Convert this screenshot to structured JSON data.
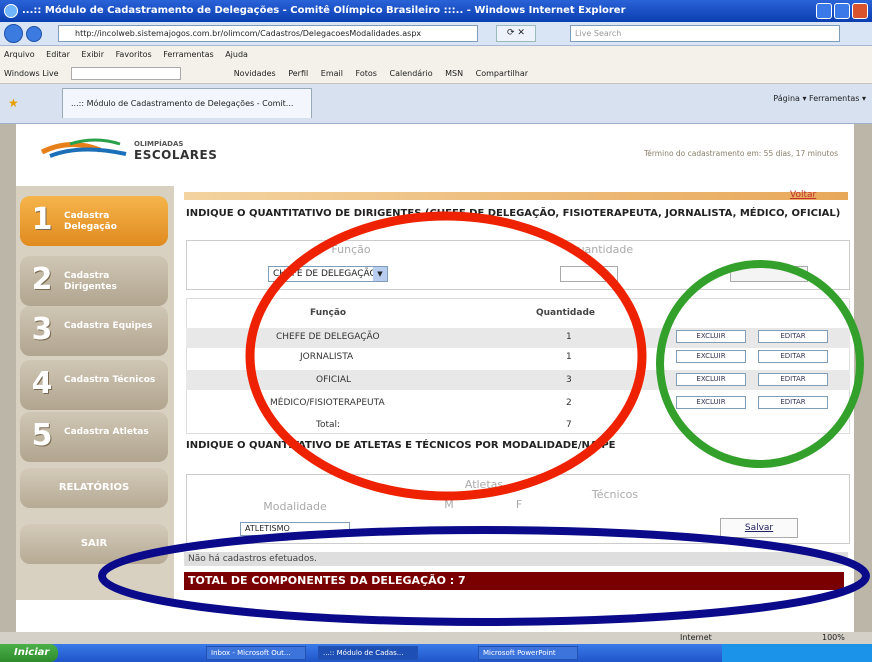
{
  "browser": {
    "title": "...:: Módulo de Cadastramento de Delegações - Comitê Olímpico Brasileiro :::.. - Windows Internet Explorer",
    "address": "http://incolweb.sistemajogos.com.br/olimcom/Cadastros/DelegacoesModalidades.aspx",
    "search_placeholder": "Live Search",
    "menu": [
      "Arquivo",
      "Editar",
      "Exibir",
      "Favoritos",
      "Ferramentas",
      "Ajuda"
    ],
    "links_bar": [
      "Windows Live",
      "Novidades",
      "Perfil",
      "Email",
      "Fotos",
      "Calendário",
      "MSN",
      "Compartilhar"
    ],
    "tab_label": "...:: Módulo de Cadastramento de Delegações - Comit...",
    "tab_tools": "Página ▾   Ferramentas ▾",
    "status_zone": "Internet",
    "zoom": "100%"
  },
  "header": {
    "logo_top": "OLIMPÍADAS",
    "logo_bottom": "ESCOLARES",
    "remaining": "Término do cadastramento em: 55 dias, 17 minutos"
  },
  "sidebar": {
    "steps": [
      {
        "num": "1",
        "label": "Cadastra Delegação"
      },
      {
        "num": "2",
        "label": "Cadastra Dirigentes"
      },
      {
        "num": "3",
        "label": "Cadastra Equipes"
      },
      {
        "num": "4",
        "label": "Cadastra Técnicos"
      },
      {
        "num": "5",
        "label": "Cadastra Atletas"
      }
    ],
    "reports": "RELATÓRIOS",
    "exit": "SAIR"
  },
  "main": {
    "back": "Voltar",
    "heading1": "INDIQUE O QUANTITATIVO DE DIRIGENTES (CHEFE DE DELEGAÇÃO, FISIOTERAPEUTA, JORNALISTA, MÉDICO, OFICIAL)",
    "form_func_header": "Função",
    "form_qty_header": "Quantidade",
    "func_selected": "CHEFE DE DELEGAÇÃO",
    "table_headers": [
      "Função",
      "Quantidade"
    ],
    "rows": [
      {
        "func": "CHEFE DE DELEGAÇÃO",
        "qty": "1"
      },
      {
        "func": "JORNALISTA",
        "qty": "1"
      },
      {
        "func": "OFICIAL",
        "qty": "3"
      },
      {
        "func": "MÉDICO/FISIOTERAPEUTA",
        "qty": "2"
      }
    ],
    "total_label": "Total:",
    "total_value": "7",
    "delete_label": "EXCLUIR",
    "edit_label": "EDITAR",
    "heading2": "INDIQUE O QUANTITATIVO DE ATLETAS E TÉCNICOS POR MODALIDADE/NAIPE",
    "athletes": "Atletas",
    "m": "M",
    "f": "F",
    "coaches": "Técnicos",
    "modality": "Modalidade",
    "modality_selected": "ATLETISMO",
    "save": "Salvar",
    "no_records": "Não há cadastros efetuados.",
    "grand_total": "TOTAL DE COMPONENTES DA DELEGAÇÃO : 7"
  },
  "taskbar": {
    "start": "Iniciar",
    "tasks": [
      "Inbox - Microsoft Out...",
      "...:: Módulo de Cadas...",
      "Microsoft PowerPoint"
    ]
  },
  "colors": {
    "red_annotation": "#ee2200",
    "green_annotation": "#33a02c",
    "blue_annotation": "#0a0a8a"
  }
}
